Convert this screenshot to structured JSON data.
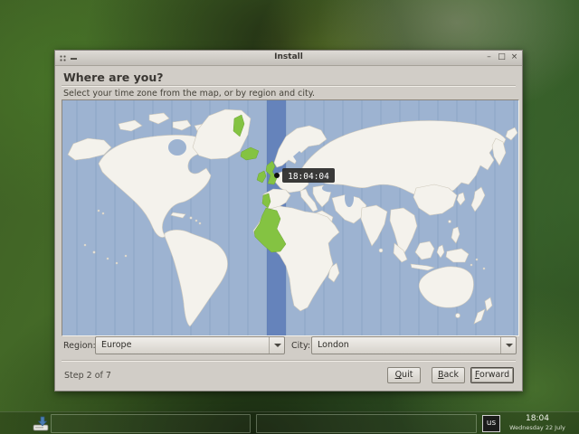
{
  "window": {
    "title": "Install",
    "controls": {
      "minimize": "–",
      "maximize": "□",
      "close": "×"
    },
    "header": {
      "title": "Where are you?",
      "subtitle": "Select your time zone from the map, or by region and city."
    },
    "map": {
      "tooltip_time": "18:04:04",
      "colors": {
        "ocean": "#9db3d1",
        "band": "#6583bb",
        "zone_line": "#51719f",
        "land": "#f4f2ec",
        "land_border": "#cfc9bb",
        "highlight": "#84c342",
        "marker": "#111111",
        "tooltip_bg": "#2e2e2e",
        "tooltip_text": "#ffffff"
      }
    },
    "form": {
      "region_label": "Region:",
      "region_value": "Europe",
      "city_label": "City:",
      "city_value": "London"
    },
    "footer": {
      "step": "Step 2 of 7",
      "quit": {
        "mnemonic": "Q",
        "rest": "uit"
      },
      "back": {
        "mnemonic": "B",
        "rest": "ack"
      },
      "forward": {
        "mnemonic": "F",
        "rest": "orward"
      }
    }
  },
  "taskbar": {
    "keyboard_layout": "us",
    "clock_time": "18:04",
    "clock_date": "Wednesday 22 July"
  }
}
